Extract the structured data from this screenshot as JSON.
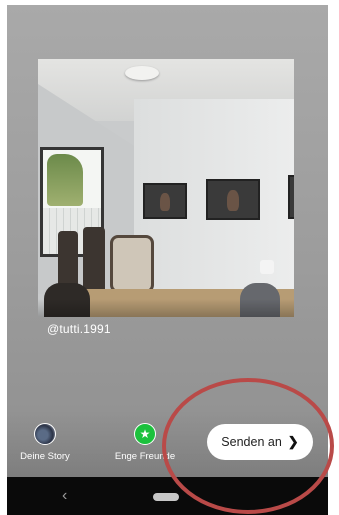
{
  "story": {
    "username_tag": "@tutti.1991"
  },
  "share_options": [
    {
      "label": "Deine Story",
      "icon": "profile-picture"
    },
    {
      "label": "Enge Freunde",
      "icon": "star-icon"
    }
  ],
  "send_button": {
    "label": "Senden an",
    "chevron": "›"
  },
  "navigation": {
    "back_glyph": "‹",
    "home": "home-pill"
  },
  "colors": {
    "friends_green": "#1cc13d",
    "annotation_red": "#b94a48",
    "nav_background": "#0a0a0a"
  }
}
